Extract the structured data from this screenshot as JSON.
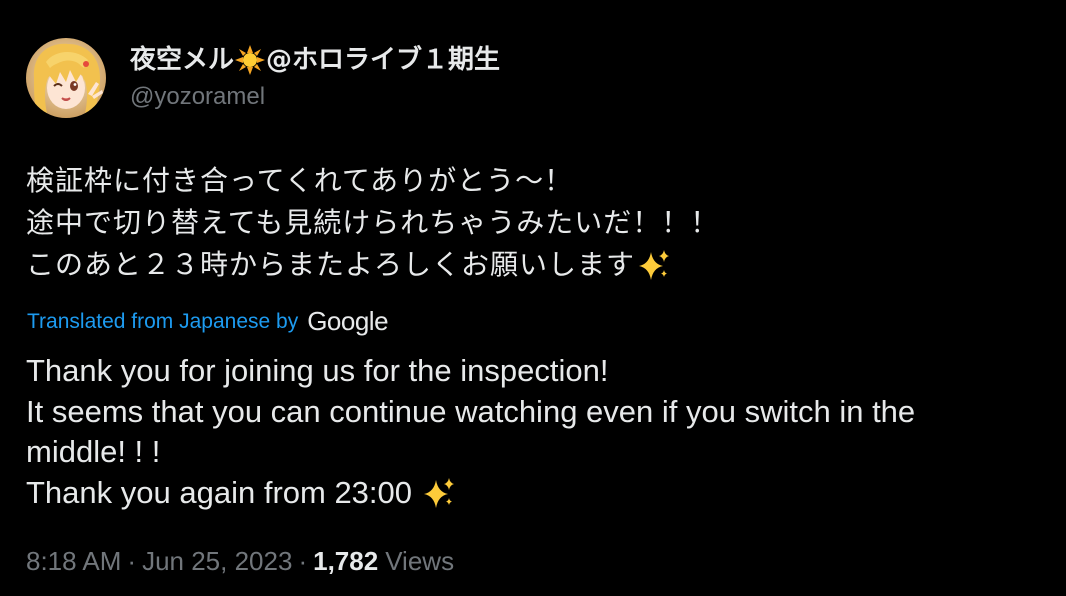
{
  "author": {
    "display_name_part1": "夜空メル",
    "display_name_part2": "@ホロライブ１期生",
    "handle": "@yozoramel",
    "avatar_icon": "avatar-icon",
    "name_emoji": "sun-emoji"
  },
  "tweet": {
    "jp_lines": [
      "検証枠に付き合ってくれてありがとう～！",
      "途中で切り替えても見続けられちゃうみたいだ！！！",
      "このあと２３時からまたよろしくお願いします"
    ],
    "jp_line3_emoji": "sparkles-emoji",
    "translated_label": "Translated from Japanese by",
    "google_label": "Google",
    "en_lines": [
      "Thank you for joining us for the inspection!",
      "It seems that you can continue watching even if you switch in the",
      "middle! ! !",
      "Thank you again from 23:00"
    ],
    "en_line4_emoji": "sparkles-emoji"
  },
  "meta": {
    "time": "8:18 AM",
    "separator": "·",
    "date": "Jun 25, 2023",
    "views_count": "1,782",
    "views_label": "Views"
  },
  "colors": {
    "background": "#000000",
    "text": "#e7e9ea",
    "muted": "#71767b",
    "link": "#1d9bf0"
  }
}
